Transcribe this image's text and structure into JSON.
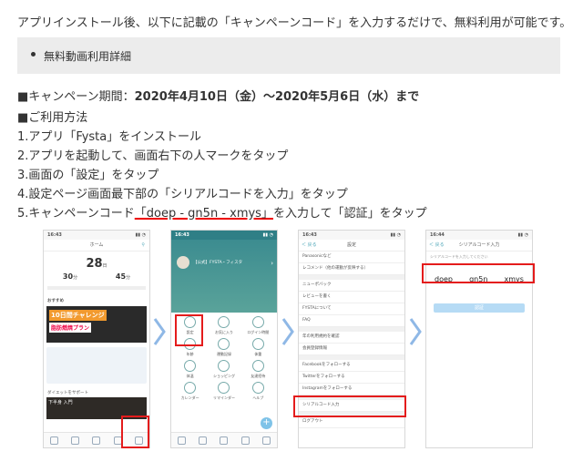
{
  "intro": "アプリインストール後、以下に記載の「キャンペーンコード」を入力するだけで、無料利用が可能です。",
  "box_item": "無料動画利用詳細",
  "period_label": "■キャンペーン期間：",
  "period_value": "2020年4月10日（金）～2020年5月6日（水）まで",
  "usage_heading": "■ご利用方法",
  "steps": [
    "1.アプリ「Fysta」をインストール",
    "2.アプリを起動して、画面右下の人マークをタップ",
    "3.画面の「設定」をタップ",
    "4.設定ページ画面最下部の「シリアルコードを入力」をタップ"
  ],
  "step5_pre": "5.キャンペーンコード",
  "step5_code": "「doep - gn5n - xmys」",
  "step5_post": "を入力して「認証」をタップ",
  "accent_red": "#e41c1c",
  "accent_blue": "#7fb3e8",
  "phone1": {
    "time": "16:43",
    "title": "ホーム",
    "big_number": "28",
    "big_unit": "日",
    "left_number": "30",
    "left_unit": "分",
    "right_number": "45",
    "right_unit": "分",
    "section": "おすすめ",
    "banner_line1": "10日間チャレンジ",
    "banner_line2": "脂肪燃焼プラン",
    "list_heading": "ダイエットをサポート",
    "footer_label": "下半身 入門"
  },
  "phone2": {
    "time": "16:43",
    "profile_name": "【公式】FYSTA・フィスタ",
    "grid": [
      "設定",
      "お気に入り",
      "ログイン時間",
      "年齢",
      "運動記録",
      "体重",
      "体温",
      "ショッピング",
      "友達招待",
      "カレンダー",
      "リマインダー",
      "ヘルプ"
    ]
  },
  "phone3": {
    "time": "16:43",
    "back": "＜ 戻る",
    "title": "設定",
    "rows": [
      "Panasonicなど",
      "レコメンド（他の運動が反映する）",
      "ニューポバック",
      "レビューを書く",
      "FYSTAについて",
      "FAQ",
      "年の利用規約を確認",
      "会員登録情報",
      "Facebookをフォローする",
      "Twitterをフォローする",
      "Instagramをフォローする",
      "シリアルコード入力",
      "ログアウト"
    ]
  },
  "phone4": {
    "time": "16:44",
    "back": "＜ 戻る",
    "title": "シリアルコード入力",
    "hint": "シリアルコードを入力してください",
    "code1": "doep",
    "code2": "gn5n",
    "code3": "xmys",
    "button": "認証"
  }
}
